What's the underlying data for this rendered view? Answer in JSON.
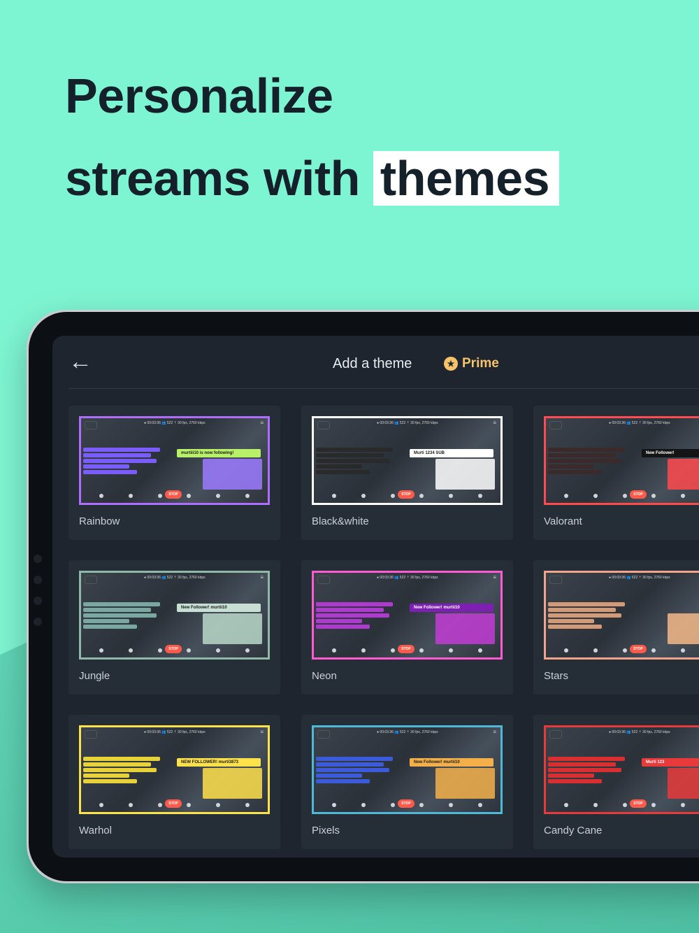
{
  "headline": {
    "line1": "Personalize",
    "line2_prefix": "streams with",
    "line2_highlight": "themes"
  },
  "screen": {
    "back_icon": "arrow-left-icon",
    "title": "Add a theme",
    "prime_label": "Prime",
    "prime_icon": "star-badge-icon"
  },
  "themes": [
    {
      "label": "Rainbow",
      "border": "#b06cff",
      "accent": "#9b7bff",
      "banner_text": "murtiii10 is now following!",
      "banner_bg": "#b8f06a",
      "chat_color": "#7b5cff"
    },
    {
      "label": "Black&white",
      "border": "#ffffff",
      "accent": "#ffffff",
      "banner_text": "Murti 1234  SUB",
      "banner_bg": "#ffffff",
      "chat_color": "#2a2a2a"
    },
    {
      "label": "Valorant",
      "border": "#ff4a4f",
      "accent": "#ff4a4f",
      "banner_text": "New Follower!",
      "banner_bg": "#141414",
      "chat_color": "#3a2a2a"
    },
    {
      "label": "Jungle",
      "border": "#8fb8a8",
      "accent": "#b8d8c8",
      "banner_text": "New Follower!  murtii10",
      "banner_bg": "#c8e0d4",
      "chat_color": "#7aa8a0"
    },
    {
      "label": "Neon",
      "border": "#ff5bd0",
      "accent": "#c23cd6",
      "banner_text": "New Follower!  murtii10",
      "banner_bg": "#7d1fb0",
      "chat_color": "#b03ad0"
    },
    {
      "label": "Stars",
      "border": "#f1a48a",
      "accent": "#f3b887",
      "banner_text": "",
      "banner_bg": "#f3b887",
      "chat_color": "#d39a78"
    },
    {
      "label": "Warhol",
      "border": "#ffe14a",
      "accent": "#ffe14a",
      "banner_text": "NEW FOLLOWER!  murti3873",
      "banner_bg": "#ffe14a",
      "chat_color": "#e8d23a"
    },
    {
      "label": "Pixels",
      "border": "#4fb8d8",
      "accent": "#f3b04a",
      "banner_text": "New Follower!  murtii10",
      "banner_bg": "#f3b04a",
      "chat_color": "#3b5bd8"
    },
    {
      "label": "Candy Cane",
      "border": "#e83a3a",
      "accent": "#e83a3a",
      "banner_text": "Murti 123",
      "banner_bg": "#e83a3a",
      "chat_color": "#d83030"
    }
  ],
  "thumb": {
    "status_text": "● 00:03:36   👥 522   ⇡ 30 fps, 2760 kbps",
    "stop_label": "STOP"
  }
}
